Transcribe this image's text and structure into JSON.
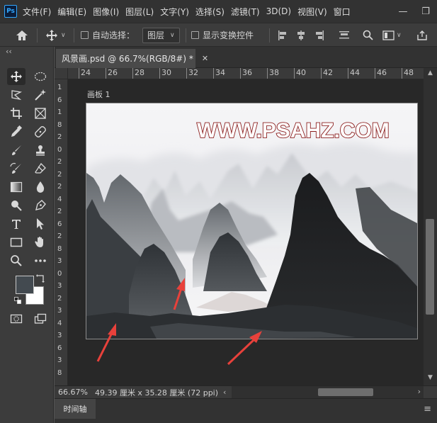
{
  "app": {
    "logo_text": "Ps"
  },
  "menu": [
    "文件(F)",
    "编辑(E)",
    "图像(I)",
    "图层(L)",
    "文字(Y)",
    "选择(S)",
    "滤镜(T)",
    "3D(D)",
    "视图(V)",
    "窗口"
  ],
  "window_controls": {
    "minimize": "—",
    "maximize": "❐"
  },
  "options": {
    "home_icon": "home-icon",
    "auto_select_label": "自动选择：",
    "auto_select_target": "图层",
    "show_transform_label": "显示变换控件",
    "auto_select_checked": false,
    "show_transform_checked": false
  },
  "toolbar": {
    "collapse": "‹‹"
  },
  "document": {
    "tab_title": "风景画.psd @ 66.7%(RGB/8#) *"
  },
  "rulers": {
    "horizontal": [
      "24",
      "26",
      "28",
      "30",
      "32",
      "34",
      "36",
      "38",
      "40",
      "42",
      "44",
      "46",
      "48"
    ],
    "vertical": [
      "1",
      "6",
      "1",
      "8",
      "2",
      "0",
      "2",
      "2",
      "2",
      "4",
      "2",
      "6",
      "2",
      "8",
      "3",
      "0",
      "3",
      "2",
      "3",
      "4",
      "3",
      "6",
      "3",
      "8"
    ]
  },
  "artboard": {
    "label": "画板 1",
    "watermark": "WWW.PSAHZ.COM"
  },
  "colors": {
    "foreground": "#434a50",
    "background": "#ffffff",
    "arrow": "#e8413b"
  },
  "status": {
    "zoom": "66.67%",
    "doc_info": "49.39 厘米 x 35.28 厘米 (72 ppi)"
  },
  "timeline": {
    "tab_label": "时间轴"
  }
}
